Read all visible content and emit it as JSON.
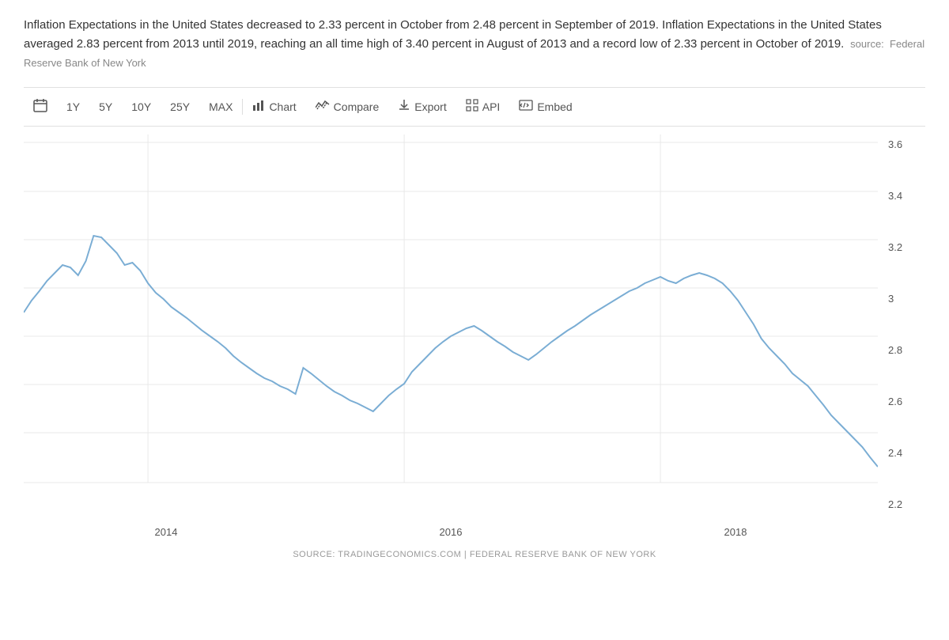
{
  "description": {
    "text": "Inflation Expectations in the United States decreased to 2.33 percent in October from 2.48 percent in September of 2019. Inflation Expectations in the United States averaged 2.83 percent from 2013 until 2019, reaching an all time high of 3.40 percent in August of 2013 and a record low of 2.33 percent in October of 2019.",
    "source_prefix": "source:",
    "source_name": "Federal Reserve Bank of New York"
  },
  "toolbar": {
    "calendar_label": "",
    "periods": [
      "1Y",
      "5Y",
      "10Y",
      "25Y",
      "MAX"
    ],
    "actions": [
      {
        "label": "Chart",
        "icon": "chart"
      },
      {
        "label": "Compare",
        "icon": "compare"
      },
      {
        "label": "Export",
        "icon": "export"
      },
      {
        "label": "API",
        "icon": "api"
      },
      {
        "label": "Embed",
        "icon": "embed"
      }
    ]
  },
  "chart": {
    "y_labels": [
      "3.6",
      "3.4",
      "3.2",
      "3",
      "2.8",
      "2.6",
      "2.4",
      "2.2"
    ],
    "x_labels": [
      "2014",
      "2016",
      "2018"
    ],
    "source_text": "SOURCE: TRADINGECONOMICS.COM | FEDERAL RESERVE BANK OF NEW YORK"
  }
}
